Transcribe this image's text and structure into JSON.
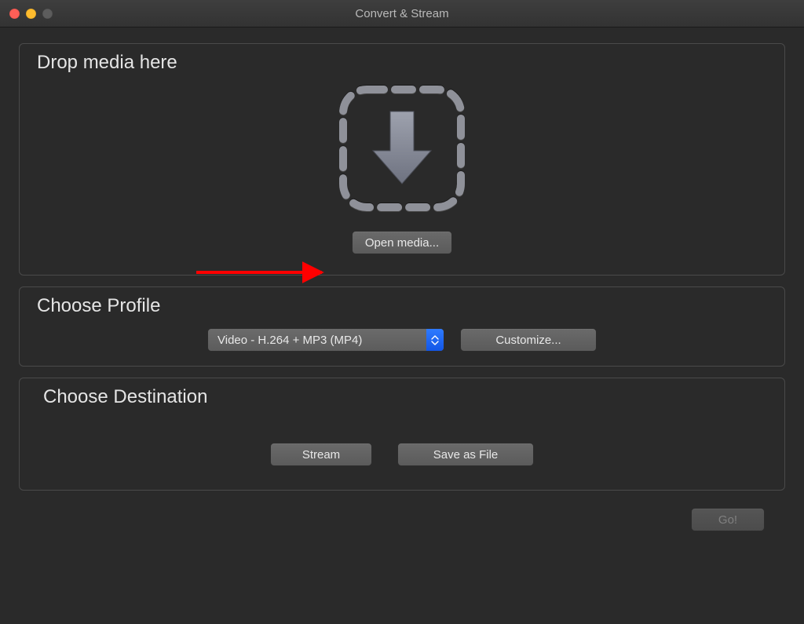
{
  "window": {
    "title": "Convert & Stream"
  },
  "drop": {
    "title": "Drop media here",
    "open_button": "Open media..."
  },
  "profile": {
    "title": "Choose Profile",
    "selected": "Video - H.264 + MP3 (MP4)",
    "customize_button": "Customize..."
  },
  "destination": {
    "title": "Choose Destination",
    "stream_button": "Stream",
    "save_button": "Save as File"
  },
  "footer": {
    "go_button": "Go!"
  },
  "icons": {
    "close": "close-icon",
    "minimize": "minimize-icon",
    "zoom": "zoom-icon",
    "drop_arrow": "download-arrow-icon",
    "select_updown": "updown-chevrons-icon"
  },
  "annotation": {
    "arrow_color": "#ff0000"
  }
}
